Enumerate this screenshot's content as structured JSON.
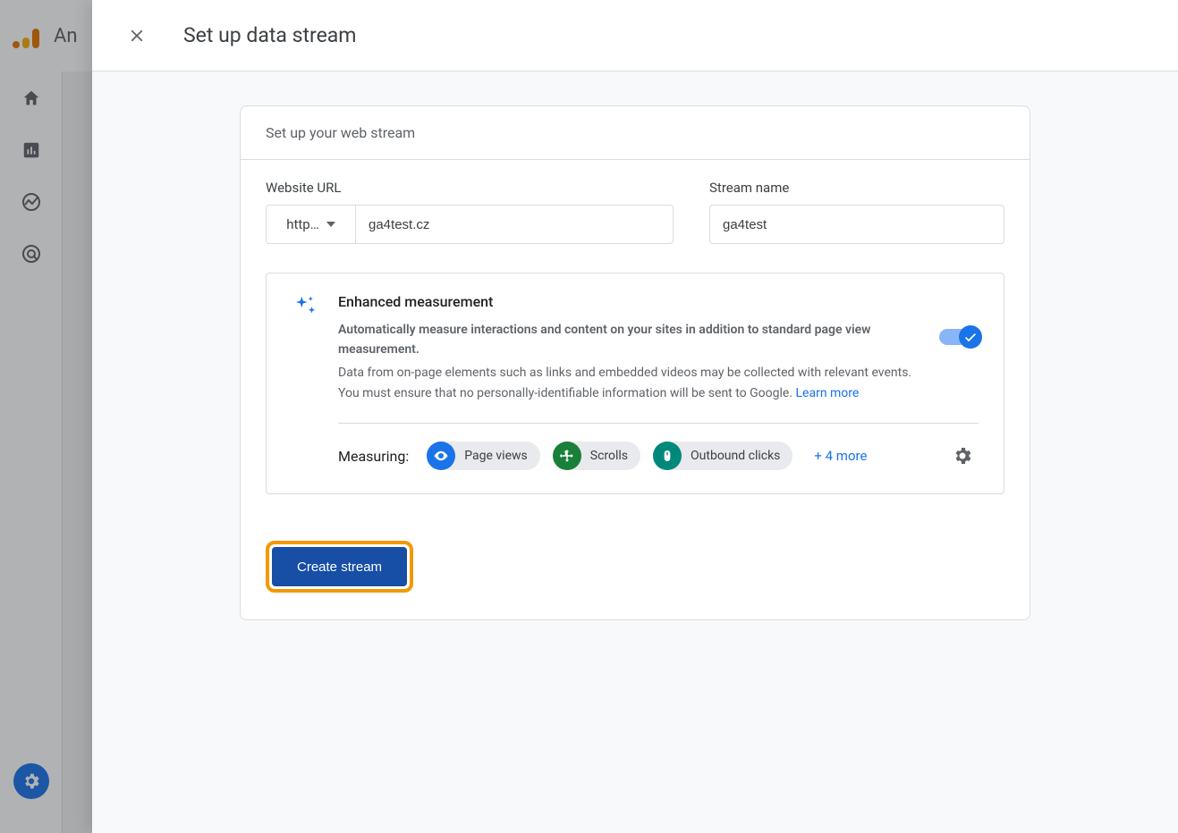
{
  "topbar": {
    "app_name": "An"
  },
  "modal": {
    "title": "Set up data stream",
    "card_title": "Set up your web stream",
    "url_label": "Website URL",
    "protocol": "http…",
    "url_value": "ga4test.cz",
    "name_label": "Stream name",
    "name_value": "ga4test",
    "enhanced": {
      "title": "Enhanced measurement",
      "p1": "Automatically measure interactions and content on your sites in addition to standard page view measurement.",
      "p2": "Data from on-page elements such as links and embedded videos may be collected with relevant events. You must ensure that no personally-identifiable information will be sent to Google. ",
      "learn_more": "Learn more"
    },
    "measuring_label": "Measuring:",
    "chips": [
      {
        "label": "Page views"
      },
      {
        "label": "Scrolls"
      },
      {
        "label": "Outbound clicks"
      }
    ],
    "more": "+ 4 more",
    "create_label": "Create stream"
  }
}
